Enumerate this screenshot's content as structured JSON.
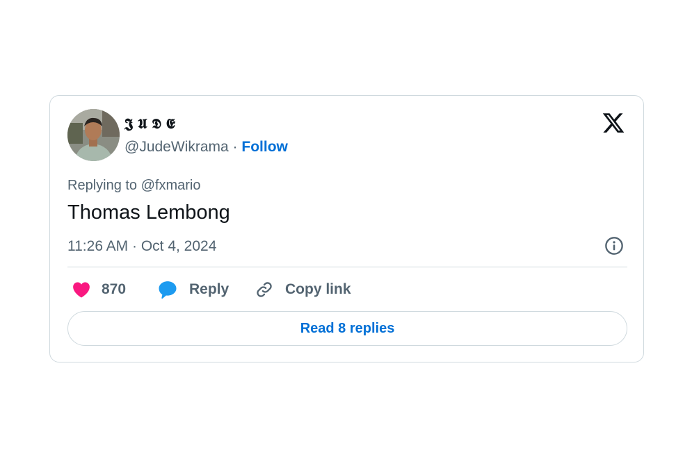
{
  "tweet": {
    "author": {
      "display_name": "𝕵 𝖀 𝕯 𝕰",
      "handle": "@JudeWikrama",
      "separator": "·",
      "follow_label": "Follow"
    },
    "replying_to": "Replying to @fxmario",
    "text": "Thomas Lembong",
    "timestamp": "11:26 AM · Oct 4, 2024",
    "actions": {
      "like_count": "870",
      "reply_label": "Reply",
      "copy_link_label": "Copy link"
    },
    "read_replies_label": "Read 8 replies",
    "icons": {
      "brand": "x-logo-icon",
      "info": "info-icon",
      "like": "heart-icon",
      "reply": "speech-bubble-icon",
      "copy": "link-icon"
    },
    "colors": {
      "like": "#f91880",
      "reply": "#1d9bf0",
      "link_text": "#006fd6",
      "muted": "#536471"
    }
  }
}
